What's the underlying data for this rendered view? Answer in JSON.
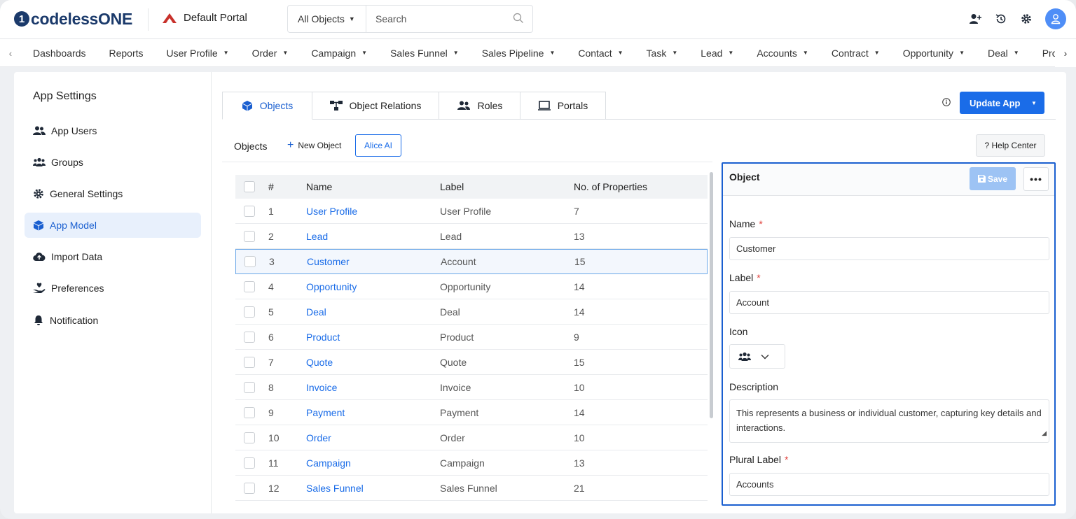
{
  "brand": {
    "logo_mark": "1",
    "logo_text": "codelessONE"
  },
  "portal": {
    "name": "Default Portal"
  },
  "search": {
    "scope": "All Objects",
    "placeholder": "Search"
  },
  "nav": {
    "items": [
      {
        "label": "Dashboards",
        "dropdown": false
      },
      {
        "label": "Reports",
        "dropdown": false
      },
      {
        "label": "User Profile",
        "dropdown": true
      },
      {
        "label": "Order",
        "dropdown": true
      },
      {
        "label": "Campaign",
        "dropdown": true
      },
      {
        "label": "Sales Funnel",
        "dropdown": true
      },
      {
        "label": "Sales Pipeline",
        "dropdown": true
      },
      {
        "label": "Contact",
        "dropdown": true
      },
      {
        "label": "Task",
        "dropdown": true
      },
      {
        "label": "Lead",
        "dropdown": true
      },
      {
        "label": "Accounts",
        "dropdown": true
      },
      {
        "label": "Contract",
        "dropdown": true
      },
      {
        "label": "Opportunity",
        "dropdown": true
      },
      {
        "label": "Deal",
        "dropdown": true
      },
      {
        "label": "Pro",
        "dropdown": false
      }
    ]
  },
  "sidebar": {
    "title": "App Settings",
    "items": [
      {
        "label": "App Users",
        "icon": "users-icon",
        "active": false
      },
      {
        "label": "Groups",
        "icon": "groups-icon",
        "active": false
      },
      {
        "label": "General Settings",
        "icon": "gear-icon",
        "active": false
      },
      {
        "label": "App Model",
        "icon": "cube-icon",
        "active": true
      },
      {
        "label": "Import Data",
        "icon": "cloud-upload-icon",
        "active": false
      },
      {
        "label": "Preferences",
        "icon": "hand-heart-icon",
        "active": false
      },
      {
        "label": "Notification",
        "icon": "bell-icon",
        "active": false
      }
    ]
  },
  "tabs": [
    {
      "label": "Objects",
      "active": true
    },
    {
      "label": "Object Relations",
      "active": false
    },
    {
      "label": "Roles",
      "active": false
    },
    {
      "label": "Portals",
      "active": false
    }
  ],
  "actions": {
    "update_app": "Update App",
    "help_center": "? Help Center"
  },
  "toolbar": {
    "objects_label": "Objects",
    "new_object": "New Object",
    "alice_ai": "Alice AI"
  },
  "table": {
    "headers": {
      "num": "#",
      "name": "Name",
      "label": "Label",
      "props": "No. of Properties"
    },
    "rows": [
      {
        "num": "1",
        "name": "User Profile",
        "label": "User Profile",
        "props": "7"
      },
      {
        "num": "2",
        "name": "Lead",
        "label": "Lead",
        "props": "13"
      },
      {
        "num": "3",
        "name": "Customer",
        "label": "Account",
        "props": "15",
        "selected": true
      },
      {
        "num": "4",
        "name": "Opportunity",
        "label": "Opportunity",
        "props": "14"
      },
      {
        "num": "5",
        "name": "Deal",
        "label": "Deal",
        "props": "14"
      },
      {
        "num": "6",
        "name": "Product",
        "label": "Product",
        "props": "9"
      },
      {
        "num": "7",
        "name": "Quote",
        "label": "Quote",
        "props": "15"
      },
      {
        "num": "8",
        "name": "Invoice",
        "label": "Invoice",
        "props": "10"
      },
      {
        "num": "9",
        "name": "Payment",
        "label": "Payment",
        "props": "14"
      },
      {
        "num": "10",
        "name": "Order",
        "label": "Order",
        "props": "10"
      },
      {
        "num": "11",
        "name": "Campaign",
        "label": "Campaign",
        "props": "13"
      },
      {
        "num": "12",
        "name": "Sales Funnel",
        "label": "Sales Funnel",
        "props": "21"
      }
    ]
  },
  "panel": {
    "title": "Object",
    "save": "Save",
    "more": "•••",
    "fields": {
      "name_label": "Name",
      "name_value": "Customer",
      "label_label": "Label",
      "label_value": "Account",
      "icon_label": "Icon",
      "description_label": "Description",
      "description_value": "This represents a business or individual customer, capturing key details and interactions.",
      "plural_label": "Plural Label",
      "plural_value": "Accounts",
      "required_mark": "*"
    }
  },
  "colors": {
    "accent": "#1a6ce8",
    "brand": "#1b3a6b",
    "save_disabled": "#9dc3f4",
    "required": "#e0413c"
  }
}
